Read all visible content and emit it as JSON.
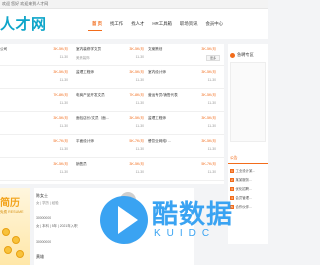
{
  "topbar": {
    "note": "欢迎 您好 欢迎来到人才网"
  },
  "logo": {
    "text": "人才网"
  },
  "nav": [
    {
      "label": "首 页"
    },
    {
      "label": "找工作"
    },
    {
      "label": "找人才"
    },
    {
      "label": "HR工具箱"
    },
    {
      "label": "职场资讯"
    },
    {
      "label": "会员中心"
    }
  ],
  "jobs": [
    [
      {
        "title": "公司",
        "salary": "3K-5K/月",
        "company": "",
        "date": "11-30"
      },
      {
        "title": "室内装修学文员",
        "salary": "3K-5K/月",
        "company": "美贵装饰",
        "date": "11-30"
      },
      {
        "title": "文案策划",
        "salary": "3K-5K/月",
        "company": "",
        "date": "11-30"
      }
    ],
    [
      {
        "title": "",
        "salary": "3K-5K/月",
        "company": "",
        "date": "11-30"
      },
      {
        "title": "监理工程师",
        "salary": "3K-5K/月",
        "company": "",
        "date": "11-30"
      },
      {
        "title": "室内设计师",
        "salary": "3K-5K/月",
        "company": "",
        "date": "11-30"
      }
    ],
    [
      {
        "title": "",
        "salary": "7K-8K/月",
        "company": "",
        "date": "11-30"
      },
      {
        "title": "电商产品开发文员",
        "salary": "7K-8K/月",
        "company": "",
        "date": "11-30"
      },
      {
        "title": "营运专员/销售代表",
        "salary": "3K-5K/月",
        "company": "",
        "date": "11-30"
      }
    ],
    [
      {
        "title": "",
        "salary": "3K-5K/月",
        "company": "",
        "date": "11-30"
      },
      {
        "title": "面包店长/文员（面...",
        "salary": "3K-5K/月",
        "company": "",
        "date": "11-30"
      },
      {
        "title": "监理工程师",
        "salary": "3K-5K/月",
        "company": "",
        "date": "11-30"
      }
    ],
    [
      {
        "title": "",
        "salary": "5K-7K/月",
        "company": "",
        "date": "11-30"
      },
      {
        "title": "平面设计师",
        "salary": "5K-7K/月",
        "company": "",
        "date": "11-30"
      },
      {
        "title": "餐饮业网络/ ...",
        "salary": "3K-5K/月",
        "company": "",
        "date": "11-30"
      }
    ],
    [
      {
        "title": "",
        "salary": "3K-5K/月",
        "company": "",
        "date": "11-30"
      },
      {
        "title": "销售员",
        "salary": "3K-5K/月",
        "company": "",
        "date": "11-30"
      },
      {
        "title": "",
        "salary": "5K-7K/月",
        "company": "",
        "date": "11-30"
      }
    ]
  ],
  "more_button": "更多",
  "sidebar": {
    "head": "急聘专区",
    "notice_title": "公告",
    "notices": [
      {
        "num": "1",
        "text": "工业设计某..."
      },
      {
        "num": "2",
        "text": "某某服务..."
      },
      {
        "num": "3",
        "text": "优化招聘..."
      },
      {
        "num": "4",
        "text": "会员管理..."
      },
      {
        "num": "5",
        "text": "合作伙伴..."
      }
    ]
  },
  "banner": {
    "big": "简历",
    "sub": "免费 RESUME"
  },
  "resumes": [
    {
      "name": "陈女士",
      "meta": "女 | 学历 | 经验",
      "line1": "30000000",
      "line2": "女 | 本科 | 5年 | 2021年入职",
      "text": ""
    },
    {
      "name": "",
      "meta": "",
      "line1": "30000000",
      "line2": "",
      "text": ""
    },
    {
      "name": "黄雄",
      "meta": "",
      "line1": "",
      "line2": "",
      "text": ""
    }
  ],
  "watermark": {
    "text": "酷数据",
    "sub": "KUIDC"
  },
  "colors": {
    "accent": "#f26c1b",
    "brand": "#0ea5c9",
    "watermark": "#3aa3f2"
  }
}
